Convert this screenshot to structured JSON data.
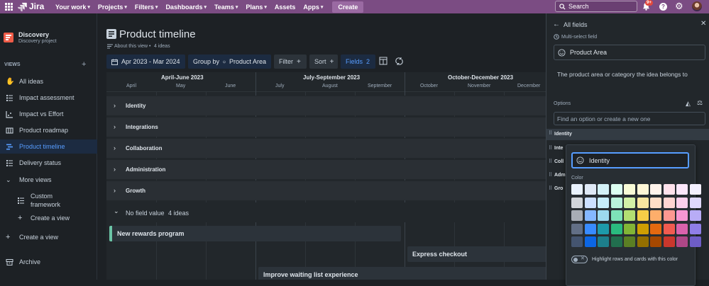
{
  "topbar": {
    "product": "Jira",
    "items": [
      "Your work",
      "Projects",
      "Filters",
      "Dashboards",
      "Teams",
      "Plans",
      "Assets",
      "Apps"
    ],
    "create_label": "Create",
    "search_placeholder": "Search",
    "notifications_badge": "9+"
  },
  "sidebar": {
    "project_name": "Discovery",
    "project_type": "Discovery project",
    "views_heading": "VIEWS",
    "items": [
      {
        "label": "All ideas"
      },
      {
        "label": "Impact assessment"
      },
      {
        "label": "Impact vs Effort"
      },
      {
        "label": "Product roadmap"
      },
      {
        "label": "Product timeline"
      },
      {
        "label": "Delivery status"
      },
      {
        "label": "More views"
      }
    ],
    "custom_framework": "Custom framework",
    "create_view_nested": "Create a view",
    "create_view": "Create a view",
    "archive": "Archive"
  },
  "main": {
    "title": "Product timeline",
    "about": "About this view",
    "separator": "•",
    "ideas_count": "4 ideas",
    "toolbar": {
      "date_range": "Apr 2023 - Mar 2024",
      "group_by": "Group by",
      "group_value": "Product Area",
      "filter": "Filter",
      "sort": "Sort",
      "fields": "Fields",
      "fields_count": "2"
    },
    "quarters": [
      "April-June 2023",
      "July-September 2023",
      "October-December 2023"
    ],
    "months": [
      "April",
      "May",
      "June",
      "July",
      "August",
      "September",
      "October",
      "November",
      "December"
    ],
    "groups": [
      "Identity",
      "Integrations",
      "Collaboration",
      "Administration",
      "Growth"
    ],
    "no_value_group": {
      "label": "No field value",
      "count": "4 ideas"
    },
    "bars": [
      "New rewards program",
      "Express checkout",
      "Improve waiting list experience"
    ]
  },
  "panel": {
    "back_label": "All fields",
    "field_type": "Multi-select field",
    "field_name": "Product Area",
    "description": "The product area or category the idea belongs to",
    "options_heading": "Options",
    "search_placeholder": "Find an option or create a new one",
    "options": [
      "Identity",
      "Inte",
      "Coll",
      "Adm",
      "Gro"
    ],
    "popup": {
      "name_value": "Identity",
      "color_heading": "Color",
      "highlight_label": "Highlight rows and cards with this color",
      "colors": [
        [
          "#e9f2fe",
          "#dfe9f6",
          "#d3f1f7",
          "#dcfff1",
          "#f8fbd6",
          "#fff7d6",
          "#fff3eb",
          "#ffe2ec",
          "#fce7fb",
          "#f3f0ff"
        ],
        [
          "#d1d5db",
          "#cce0ff",
          "#c6edfb",
          "#baf3db",
          "#d3f1a7",
          "#f8e6a0",
          "#fedec8",
          "#ffd5d2",
          "#fdd0ec",
          "#dfd8fd"
        ],
        [
          "#a8adb5",
          "#85b8ff",
          "#9dd9ee",
          "#7ee2b8",
          "#b3df72",
          "#f5cd47",
          "#fdae6b",
          "#fd9891",
          "#f797d2",
          "#b8acf6"
        ],
        [
          "#626f86",
          "#388bff",
          "#1d9aaa",
          "#2abb7f",
          "#82b536",
          "#cf9f02",
          "#e56910",
          "#f15b50",
          "#da62ac",
          "#8f7ee7"
        ],
        [
          "#44546f",
          "#0c66e4",
          "#1d7f8c",
          "#216e4e",
          "#5b7f24",
          "#946f00",
          "#a54800",
          "#c9372c",
          "#ae4787",
          "#6e5dc6"
        ]
      ]
    }
  },
  "colors": {
    "topbar": "#7b4c83",
    "accent": "#579dff",
    "toolbar_button": "#1c2b41"
  }
}
